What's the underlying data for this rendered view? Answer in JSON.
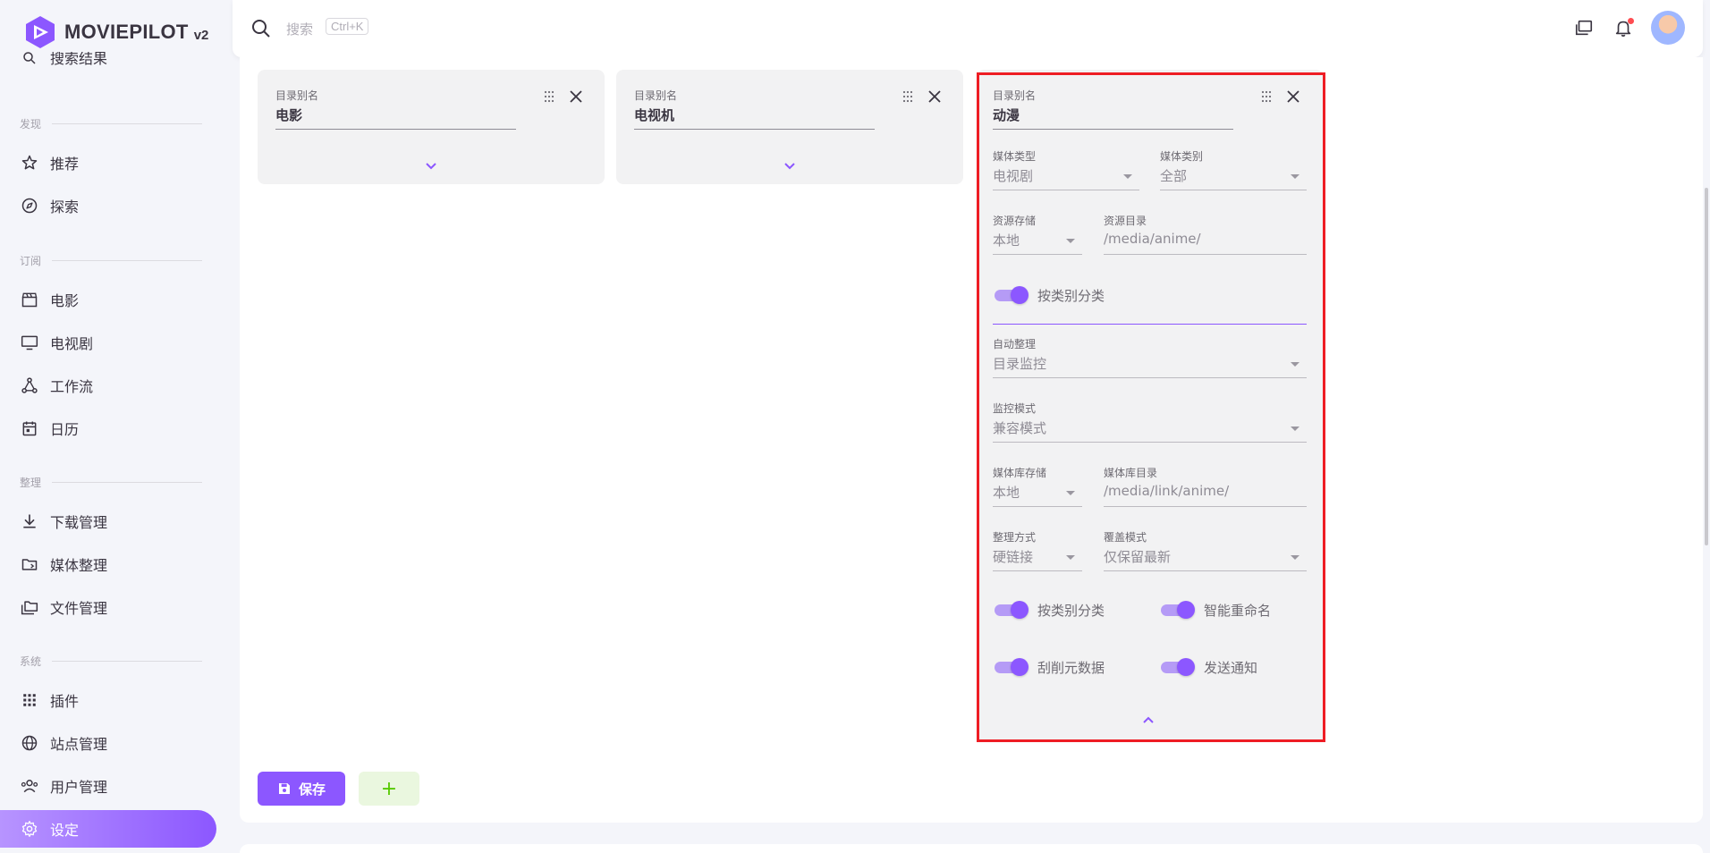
{
  "app": {
    "name": "MOVIEPILOT",
    "version": "v2"
  },
  "topbar": {
    "search_label": "搜索",
    "search_shortcut": "Ctrl+K"
  },
  "sidebar": {
    "partial_item": "搜索结果",
    "sections": [
      {
        "title": "发现",
        "items": [
          "推荐",
          "探索"
        ]
      },
      {
        "title": "订阅",
        "items": [
          "电影",
          "电视剧",
          "工作流",
          "日历"
        ]
      },
      {
        "title": "整理",
        "items": [
          "下载管理",
          "媒体整理",
          "文件管理"
        ]
      },
      {
        "title": "系统",
        "items": [
          "插件",
          "站点管理",
          "用户管理",
          "设定"
        ]
      }
    ],
    "active": "设定"
  },
  "cards": [
    {
      "alias_label": "目录别名",
      "alias_value": "电影"
    },
    {
      "alias_label": "目录别名",
      "alias_value": "电视机"
    },
    {
      "alias_label": "目录别名",
      "alias_value": "动漫",
      "media_type_label": "媒体类型",
      "media_type_value": "电视剧",
      "media_category_label": "媒体类别",
      "media_category_value": "全部",
      "resource_storage_label": "资源存储",
      "resource_storage_value": "本地",
      "resource_dir_label": "资源目录",
      "resource_dir_value": "/media/anime/",
      "classify_switch_1": "按类别分类",
      "auto_organize_label": "自动整理",
      "auto_organize_value": "目录监控",
      "monitor_mode_label": "监控模式",
      "monitor_mode_value": "兼容模式",
      "library_storage_label": "媒体库存储",
      "library_storage_value": "本地",
      "library_dir_label": "媒体库目录",
      "library_dir_value": "/media/link/anime/",
      "organize_method_label": "整理方式",
      "organize_method_value": "硬链接",
      "overwrite_mode_label": "覆盖模式",
      "overwrite_mode_value": "仅保留最新",
      "switches": [
        "按类别分类",
        "智能重命名",
        "刮削元数据",
        "发送通知"
      ]
    }
  ],
  "actions": {
    "save_label": "保存",
    "add_label": "+"
  },
  "colors": {
    "accent": "#8c57ff",
    "highlight": "#ee1d24",
    "add_bg": "#eaf7df",
    "add_fg": "#56ca00"
  }
}
